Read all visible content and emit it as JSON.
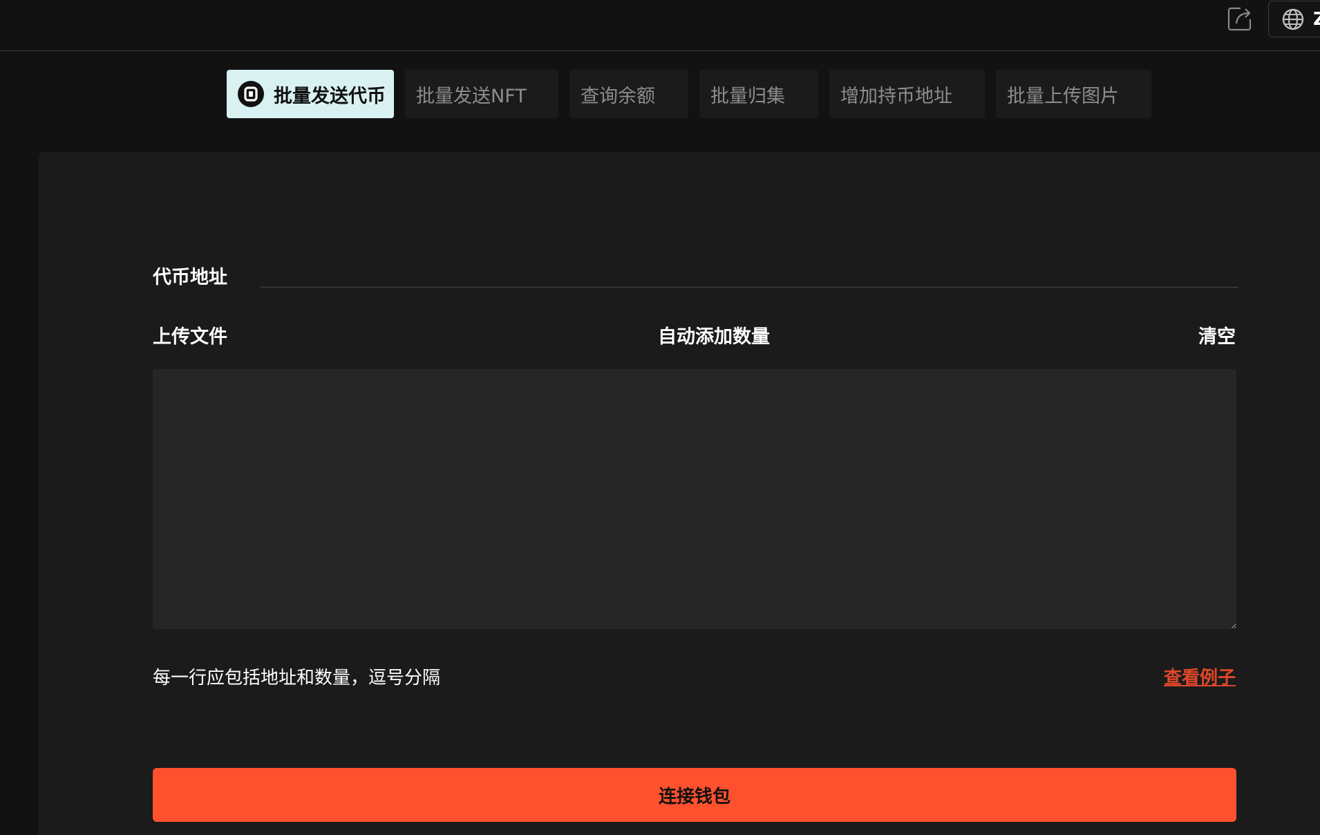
{
  "header": {
    "share_icon": "share-icon",
    "language": {
      "icon": "globe-icon",
      "label": "Z"
    }
  },
  "tabs": [
    {
      "label": "批量发送代币",
      "active": true,
      "icon": "token-logo-icon"
    },
    {
      "label": "批量发送NFT",
      "active": false
    },
    {
      "label": "查询余额",
      "active": false
    },
    {
      "label": "批量归集",
      "active": false
    },
    {
      "label": "增加持币地址",
      "active": false
    },
    {
      "label": "批量上传图片",
      "active": false
    }
  ],
  "form": {
    "token_address_label": "代币地址",
    "token_address_value": "",
    "upload_file_label": "上传文件",
    "auto_add_amount_label": "自动添加数量",
    "clear_label": "清空",
    "textarea_value": "",
    "hint": "每一行应包括地址和数量，逗号分隔",
    "example_link": "查看例子",
    "connect_button": "连接钱包"
  },
  "colors": {
    "background": "#121212",
    "panel": "#1b1b1b",
    "active_tab": "#d9f1f1",
    "accent": "#ff512d",
    "link": "#e0472a"
  }
}
